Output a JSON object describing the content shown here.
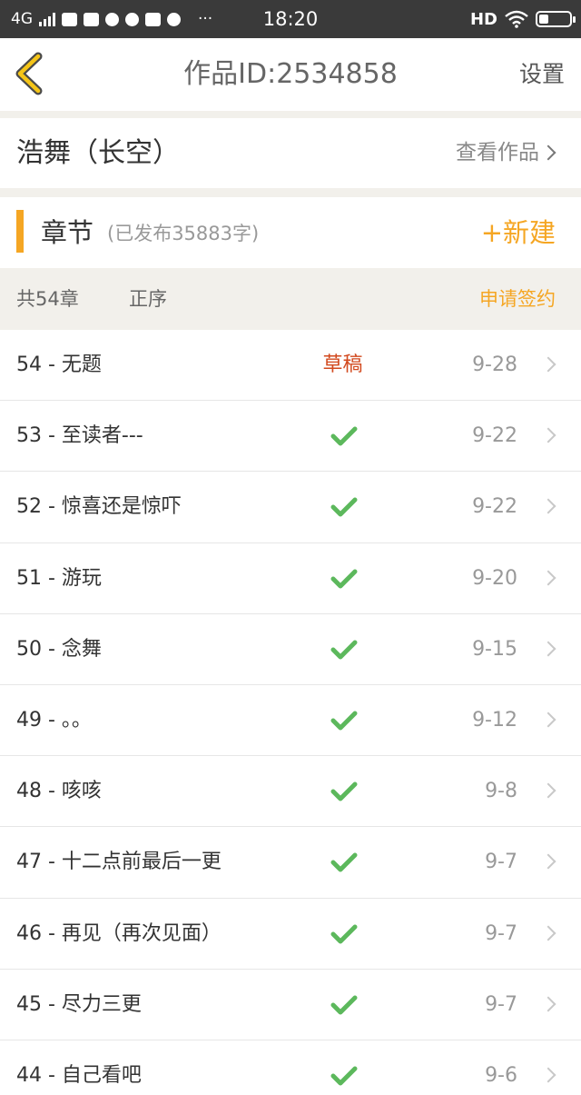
{
  "status_bar": {
    "network": "4G",
    "time": "18:20",
    "more": "···",
    "hd": "HD",
    "icons": [
      "signal-icon",
      "cloud-icon",
      "image-icon",
      "qq-icon",
      "chat-icon",
      "mail-icon",
      "bulb-icon",
      "wifi-icon",
      "battery-icon"
    ]
  },
  "nav": {
    "title": "作品ID:2534858",
    "settings": "设置",
    "accent_color": "#f5a623"
  },
  "work": {
    "name": "浩舞（长空）",
    "view_label": "查看作品"
  },
  "chapters_header": {
    "title": "章节",
    "subtitle": "(已发布35883字)",
    "new_button": "+新建"
  },
  "sort_bar": {
    "count": "共54章",
    "order": "正序",
    "sign": "申请签约"
  },
  "chapters": [
    {
      "title": "54 - 无题",
      "status": "草稿",
      "published": false,
      "date": "9-28"
    },
    {
      "title": "53 - 至读者---",
      "status": "",
      "published": true,
      "date": "9-22"
    },
    {
      "title": "52 - 惊喜还是惊吓",
      "status": "",
      "published": true,
      "date": "9-22"
    },
    {
      "title": "51 - 游玩",
      "status": "",
      "published": true,
      "date": "9-20"
    },
    {
      "title": "50 - 念舞",
      "status": "",
      "published": true,
      "date": "9-15"
    },
    {
      "title": "49 - 。。",
      "status": "",
      "published": true,
      "date": "9-12"
    },
    {
      "title": "48 - 咳咳",
      "status": "",
      "published": true,
      "date": "9-8"
    },
    {
      "title": "47 - 十二点前最后一更",
      "status": "",
      "published": true,
      "date": "9-7"
    },
    {
      "title": "46 - 再见（再次见面）",
      "status": "",
      "published": true,
      "date": "9-7"
    },
    {
      "title": "45 - 尽力三更",
      "status": "",
      "published": true,
      "date": "9-7"
    },
    {
      "title": "44 - 自己看吧",
      "status": "",
      "published": true,
      "date": "9-6"
    }
  ]
}
